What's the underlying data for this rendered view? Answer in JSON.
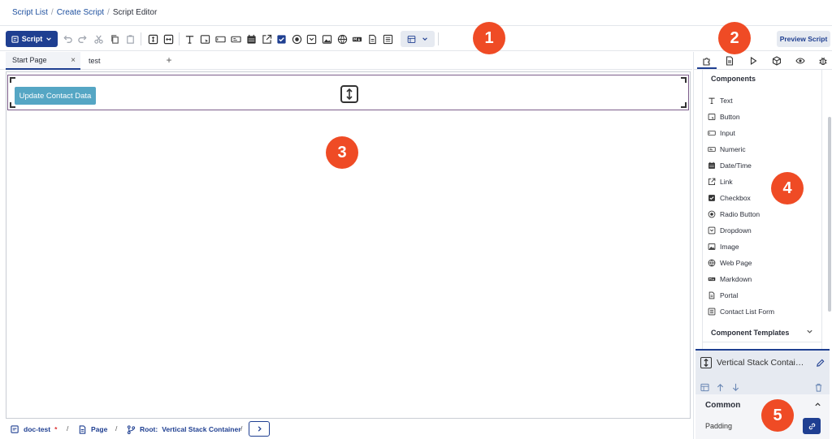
{
  "breadcrumb": {
    "items": [
      "Script List",
      "Create Script"
    ],
    "current": "Script Editor",
    "separator": "/"
  },
  "toolbar": {
    "script_label": "Script",
    "preview_label": "Preview Script",
    "icons": [
      "undo-icon",
      "redo-icon",
      "cut-icon",
      "copy-icon",
      "paste-icon",
      "vertical-stack-icon",
      "horizontal-stack-icon",
      "text-icon",
      "button-icon",
      "input-icon",
      "numeric-icon",
      "datetime-icon",
      "link-icon",
      "checkbox-icon",
      "radio-icon",
      "dropdown-icon",
      "image-icon",
      "webpage-icon",
      "markdown-icon",
      "portal-icon",
      "contact-list-form-icon",
      "layout-icon"
    ]
  },
  "tabs": [
    {
      "label": "Start Page",
      "close": "×"
    },
    {
      "label": "test"
    }
  ],
  "add_tab": "+",
  "canvas": {
    "button_label": "Update Contact Data"
  },
  "status": {
    "doc": "doc-test",
    "modified": "*",
    "page": "Page",
    "root_label": "Root:",
    "root_value": "Vertical Stack Container",
    "sep": "/",
    "next": "›"
  },
  "panel": {
    "tabs": [
      "puzzle-icon",
      "document-icon",
      "play-icon",
      "cube-icon",
      "eye-icon",
      "bug-icon"
    ],
    "components_title": "Components",
    "components": [
      {
        "label": "Text",
        "icon": "text-icon"
      },
      {
        "label": "Button",
        "icon": "button-icon"
      },
      {
        "label": "Input",
        "icon": "input-icon"
      },
      {
        "label": "Numeric",
        "icon": "numeric-icon"
      },
      {
        "label": "Date/Time",
        "icon": "calendar-icon"
      },
      {
        "label": "Link",
        "icon": "link-icon"
      },
      {
        "label": "Checkbox",
        "icon": "checkbox-icon"
      },
      {
        "label": "Radio Button",
        "icon": "radio-icon"
      },
      {
        "label": "Dropdown",
        "icon": "dropdown-icon"
      },
      {
        "label": "Image",
        "icon": "image-icon"
      },
      {
        "label": "Web Page",
        "icon": "globe-icon"
      },
      {
        "label": "Markdown",
        "icon": "markdown-icon"
      },
      {
        "label": "Portal",
        "icon": "portal-icon"
      },
      {
        "label": "Contact List Form",
        "icon": "form-icon"
      }
    ],
    "templates_title": "Component Templates",
    "selected_name": "Vertical Stack Container",
    "common_title": "Common",
    "padding_label": "Padding"
  },
  "callouts": [
    "1",
    "2",
    "3",
    "4",
    "5"
  ],
  "colors": {
    "primary": "#1f3f91",
    "canvas_button": "#55a6c4",
    "callout": "#ef4b25"
  }
}
